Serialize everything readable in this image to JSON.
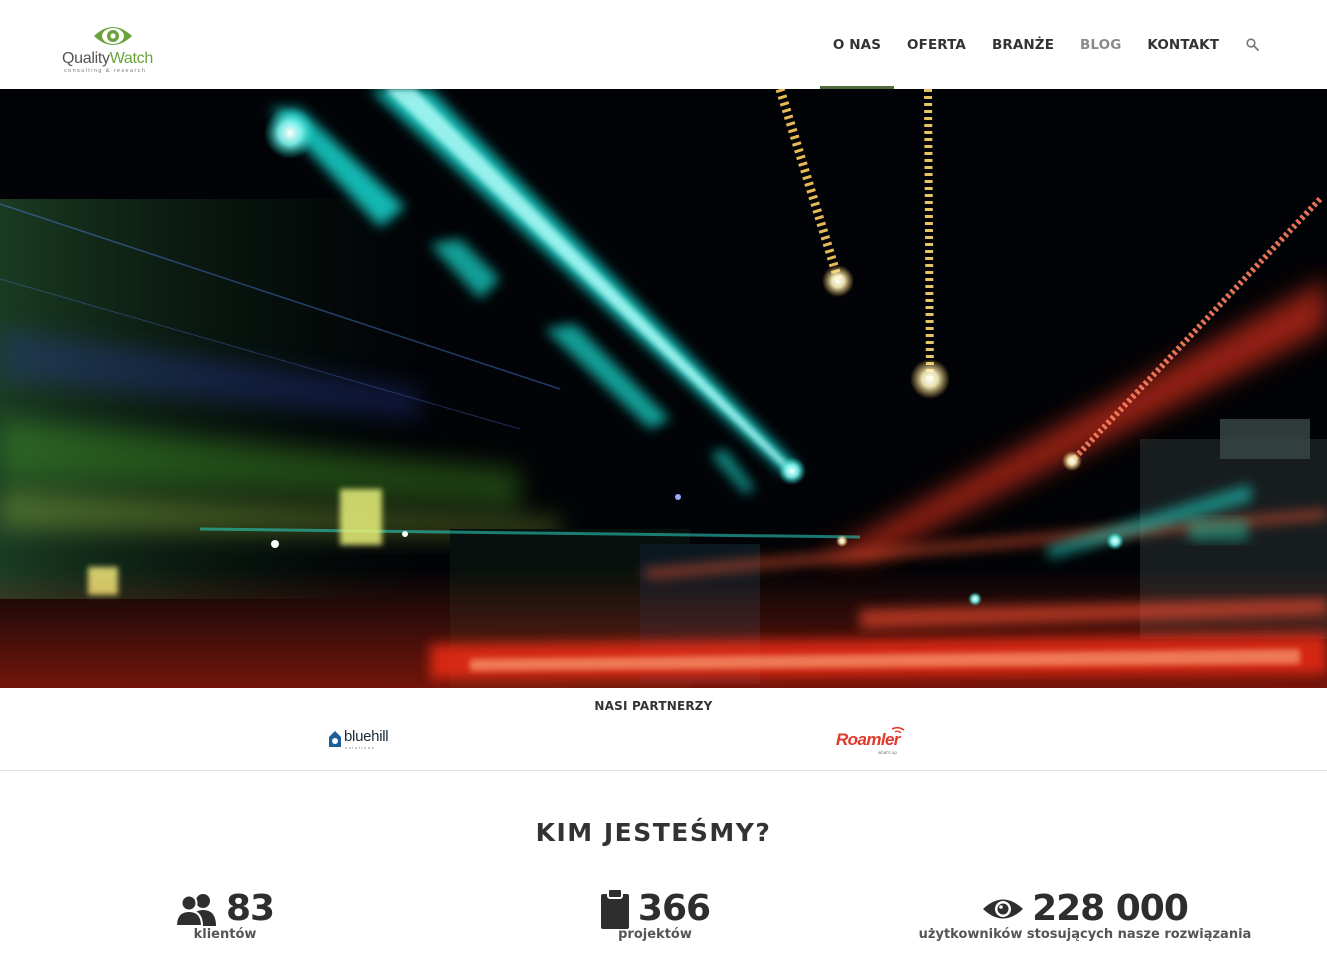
{
  "brand": {
    "name_part1": "Quality",
    "name_part2": "Watch",
    "tagline": "consulting & research",
    "logo_color": "#6aa33a"
  },
  "nav": {
    "items": [
      {
        "label": "O NAS",
        "active": true
      },
      {
        "label": "OFERTA",
        "active": false
      },
      {
        "label": "BRANŻE",
        "active": false
      },
      {
        "label": "BLOG",
        "active": false
      },
      {
        "label": "KONTAKT",
        "active": false
      }
    ],
    "search_icon": "search-icon",
    "active_color": "#4f6b3a"
  },
  "hero": {
    "image": "night-city-light-trails"
  },
  "partners": {
    "title": "NASI PARTNERZY",
    "items": [
      {
        "name": "bluehill",
        "sub": "solutions"
      },
      {
        "name": "Roamler",
        "sub": "what's up"
      }
    ]
  },
  "about": {
    "title": "KIM JESTEŚMY?",
    "stats": [
      {
        "icon": "users-icon",
        "value": "83",
        "label": "klientów"
      },
      {
        "icon": "clipboard-icon",
        "value": "366",
        "label": "projektów"
      },
      {
        "icon": "eye-icon",
        "value": "228 000",
        "label": "użytkowników stosujących nasze rozwiązania"
      }
    ]
  }
}
